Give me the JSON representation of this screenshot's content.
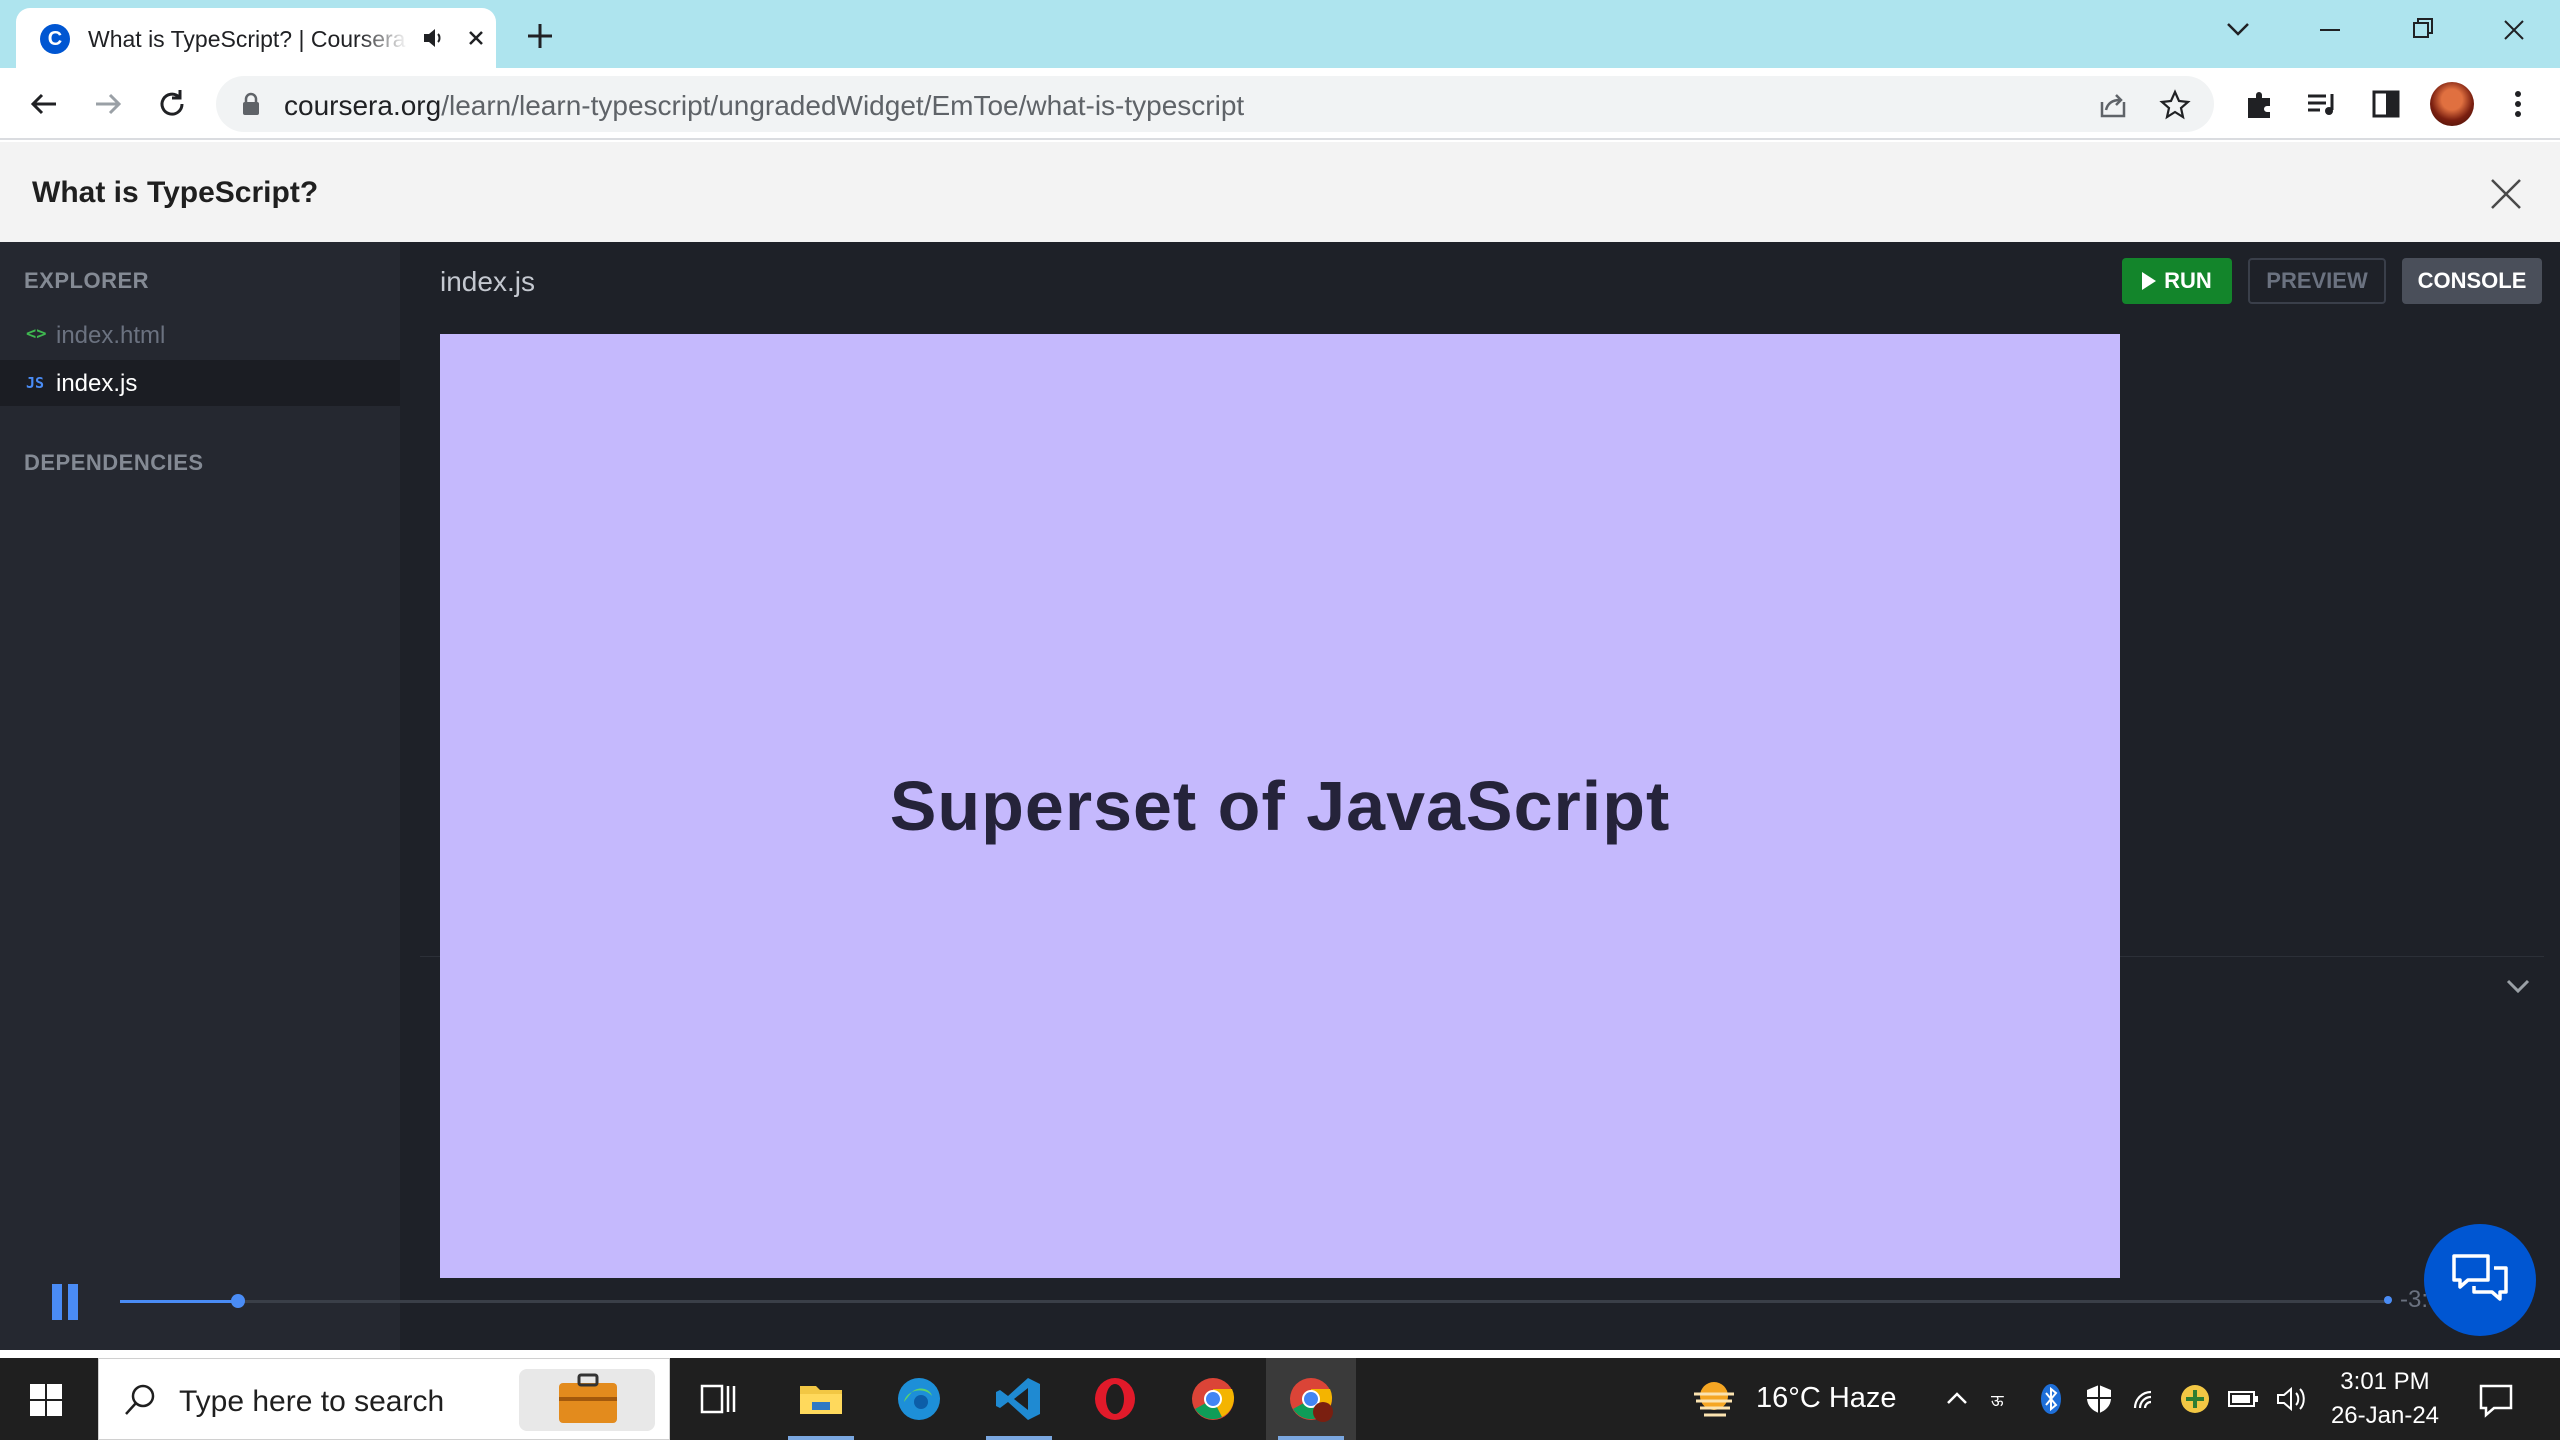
{
  "browser": {
    "tab_title": "What is TypeScript? | Coursera",
    "favicon_letter": "C",
    "url_host": "coursera.org",
    "url_path": "/learn/learn-typescript/ungradedWidget/EmToe/what-is-typescript"
  },
  "page": {
    "title": "What is TypeScript?"
  },
  "sidebar": {
    "explorer_label": "EXPLORER",
    "files": [
      {
        "glyph": "<>",
        "name": "index.html"
      },
      {
        "glyph": "JS",
        "name": "index.js"
      }
    ],
    "dependencies_label": "DEPENDENCIES"
  },
  "editor": {
    "active_file": "index.js",
    "run_label": "RUN",
    "preview_label": "PREVIEW",
    "console_label": "CONSOLE"
  },
  "video": {
    "slide_text": "Superset of JavaScript",
    "progress": 0.052,
    "time_remaining": "-3:36"
  },
  "taskbar": {
    "search_placeholder": "Type here to search",
    "weather": "16°C  Haze",
    "time": "3:01 PM",
    "date": "26-Jan-24"
  },
  "colors": {
    "slide_background": "#c5b9fd",
    "run_button": "#13852b",
    "coursera_blue": "#0056d2"
  }
}
